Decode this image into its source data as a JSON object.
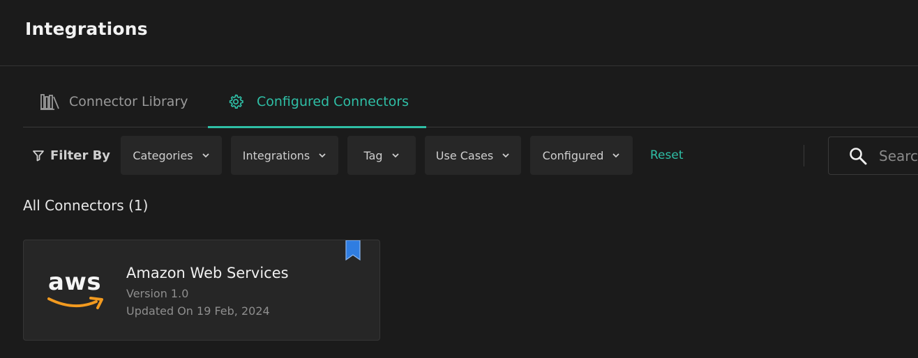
{
  "header": {
    "title": "Integrations"
  },
  "tabs": [
    {
      "label": "Connector Library",
      "icon": "library-icon",
      "active": false
    },
    {
      "label": "Configured Connectors",
      "icon": "gear-icon",
      "active": true
    }
  ],
  "filters": {
    "label": "Filter By",
    "dropdowns": [
      "Categories",
      "Integrations",
      "Tag",
      "Use Cases",
      "Configured"
    ],
    "reset_label": "Reset",
    "search_placeholder": "Search"
  },
  "section": {
    "title": "All Connectors (1)"
  },
  "connectors": [
    {
      "logo_text": "aws",
      "name": "Amazon Web Services",
      "version": "Version 1.0",
      "updated": "Updated On 19 Feb, 2024",
      "bookmarked": true
    }
  ],
  "colors": {
    "accent": "#2fbfa6",
    "background": "#1b1b1b",
    "card": "#262626",
    "bookmark": "#2f7de1",
    "aws_orange": "#f29a1f"
  }
}
